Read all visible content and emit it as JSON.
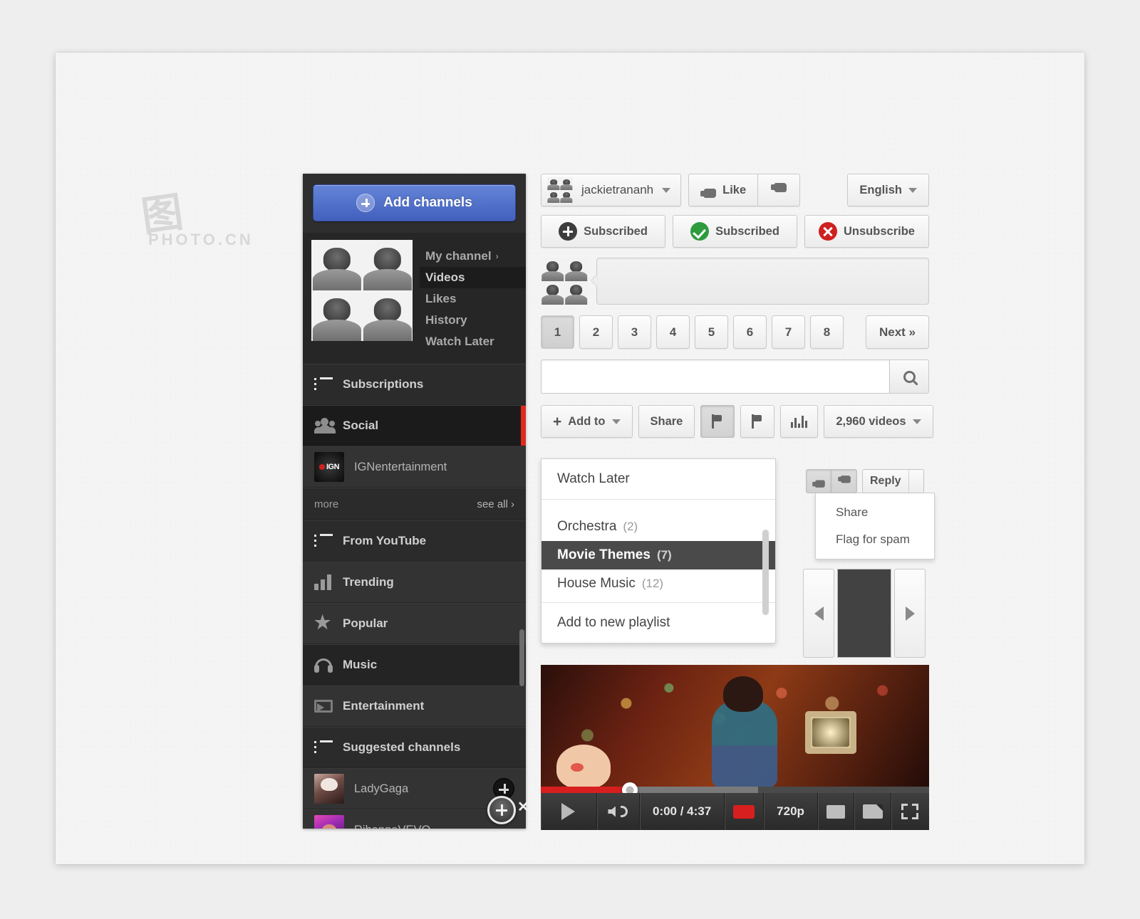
{
  "sidebar": {
    "add_channels_label": "Add channels",
    "profile_links": [
      {
        "label": "My channel",
        "caret": "›",
        "active": false
      },
      {
        "label": "Videos",
        "active": true
      },
      {
        "label": "Likes",
        "active": false
      },
      {
        "label": "History",
        "active": false
      },
      {
        "label": "Watch Later",
        "active": false
      }
    ],
    "subscriptions_header": "Subscriptions",
    "social_label": "Social",
    "channel_ign": "IGNentertainment",
    "ign_logo_text": "IGN",
    "more_label": "more",
    "see_all_label": "see all ›",
    "from_youtube_header": "From YouTube",
    "categories": [
      {
        "label": "Trending",
        "icon": "bar-chart-icon"
      },
      {
        "label": "Popular",
        "icon": "star-icon"
      },
      {
        "label": "Music",
        "icon": "headphones-icon"
      },
      {
        "label": "Entertainment",
        "icon": "film-icon"
      }
    ],
    "suggested_header": "Suggested channels",
    "suggested": [
      {
        "label": "LadyGaga"
      },
      {
        "label": "RihannaVEVO"
      }
    ]
  },
  "toolbar": {
    "account_name": "jackietrananh",
    "like_label": "Like",
    "language_label": "English",
    "subscribed_plus_label": "Subscribed",
    "subscribed_check_label": "Subscribed",
    "unsubscribe_label": "Unsubscribe"
  },
  "comment": {
    "placeholder": ""
  },
  "pagination": {
    "pages": [
      "1",
      "2",
      "3",
      "4",
      "5",
      "6",
      "7",
      "8"
    ],
    "current": "1",
    "next_label": "Next »"
  },
  "search": {
    "value": "",
    "placeholder": ""
  },
  "actions": {
    "add_to_label": "Add to",
    "share_label": "Share",
    "video_count_label": "2,960 videos"
  },
  "add_to_menu": {
    "watch_later": "Watch Later",
    "playlists": [
      {
        "name": "Orchestra",
        "count": "(2)",
        "selected": false
      },
      {
        "name": "Movie Themes",
        "count": "(7)",
        "selected": true
      },
      {
        "name": "House Music",
        "count": "(12)",
        "selected": false
      }
    ],
    "new_playlist": "Add to new playlist"
  },
  "reply": {
    "button_label": "Reply",
    "menu": [
      "Share",
      "Flag for spam"
    ]
  },
  "player": {
    "current_time": "0:00",
    "duration": "4:37",
    "time_display": "0:00 / 4:37",
    "quality": "720p"
  },
  "colors": {
    "accent_red": "#e02a1e",
    "blue_button": "#4260bd",
    "green_check": "#2e9b3e",
    "red_badge": "#cf2020",
    "sidebar_bg": "#333333",
    "selected_row": "#1b1b1b"
  }
}
